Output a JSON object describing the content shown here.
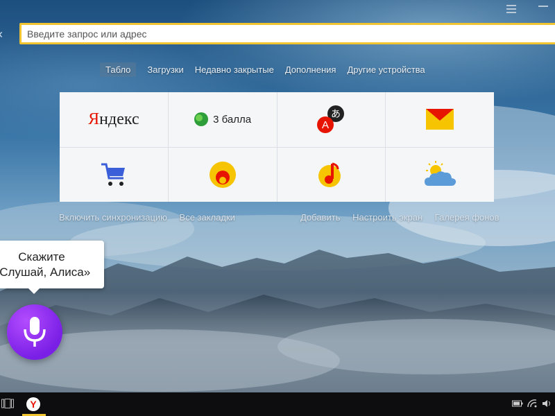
{
  "address_bar": {
    "placeholder": "Введите запрос или адрес",
    "value": ""
  },
  "nav_tabs": [
    {
      "label": "Табло",
      "active": true
    },
    {
      "label": "Загрузки",
      "active": false
    },
    {
      "label": "Недавно закрытые",
      "active": false
    },
    {
      "label": "Дополнения",
      "active": false
    },
    {
      "label": "Другие устройства",
      "active": false
    }
  ],
  "tiles": {
    "t1": {
      "icon": "yandex-logo",
      "logo_first": "Я",
      "logo_rest": "ндекс"
    },
    "t2": {
      "icon": "ball-icon",
      "label": "3 балла"
    },
    "t3": {
      "icon": "translate-icon",
      "glyph_a": "A",
      "glyph_b": "あ"
    },
    "t4": {
      "icon": "mail-envelope-icon"
    },
    "t5": {
      "icon": "shopping-cart-icon"
    },
    "t6": {
      "icon": "zen-icon"
    },
    "t7": {
      "icon": "music-note-icon"
    },
    "t8": {
      "icon": "weather-icon"
    }
  },
  "links_left": [
    "Включить синхронизацию",
    "Все закладки"
  ],
  "links_right": [
    "Добавить",
    "Настроить экран",
    "Галерея фонов"
  ],
  "alice": {
    "bubble_line1": "Скажите",
    "bubble_line2": "«Слушай, Алиса»"
  },
  "taskbar": {
    "app_glyph": "Y"
  },
  "colors": {
    "accent_yellow": "#f3c431",
    "yandex_red": "#e61400",
    "alice_purple": "#8a2be2"
  }
}
